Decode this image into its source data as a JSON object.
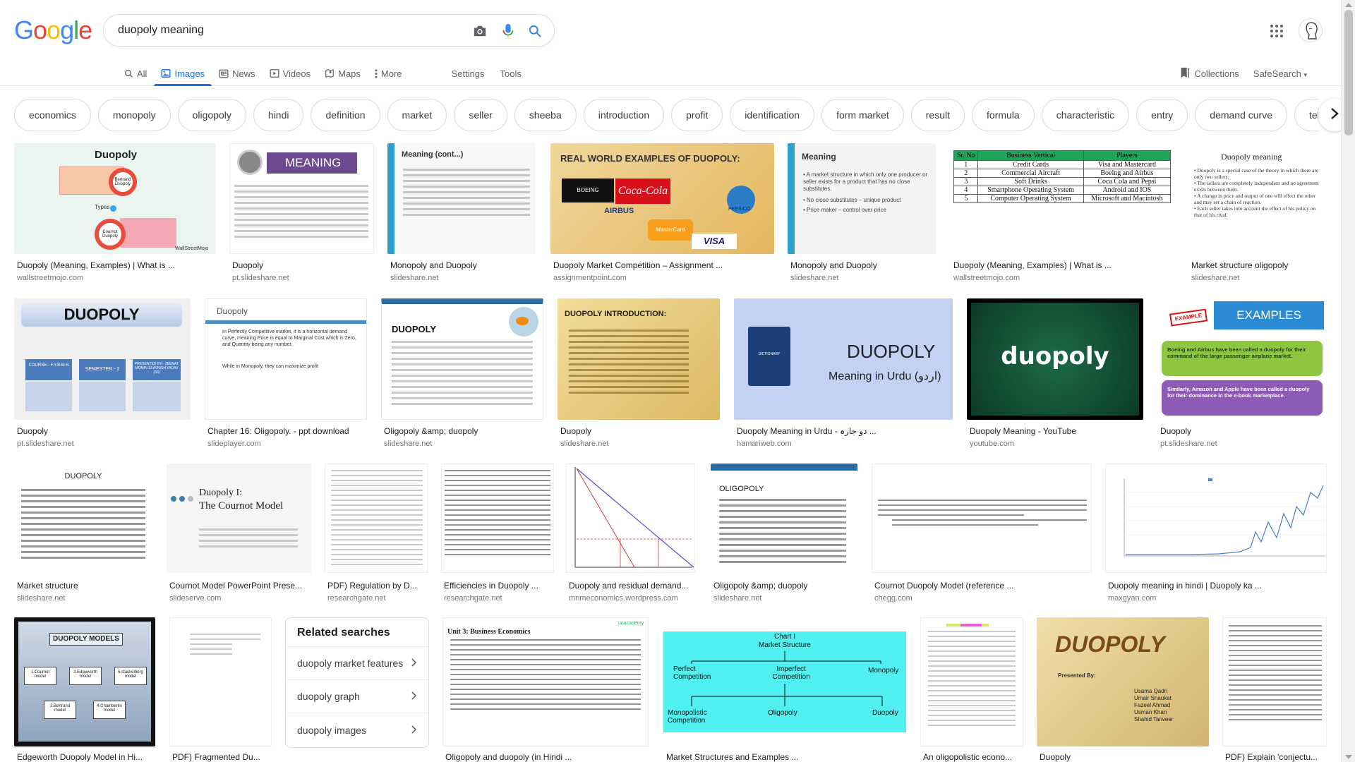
{
  "logo": [
    "G",
    "o",
    "o",
    "g",
    "l",
    "e"
  ],
  "search": {
    "query": "duopoly meaning"
  },
  "tabs": [
    {
      "label": "All"
    },
    {
      "label": "Images"
    },
    {
      "label": "News"
    },
    {
      "label": "Videos"
    },
    {
      "label": "Maps"
    },
    {
      "label": "More"
    }
  ],
  "settings_label": "Settings",
  "tools_label": "Tools",
  "collections_label": "Collections",
  "safesearch_label": "SafeSearch",
  "chips": [
    "economics",
    "monopoly",
    "oligopoly",
    "hindi",
    "definition",
    "market",
    "seller",
    "sheeba",
    "introduction",
    "profit",
    "identification",
    "form market",
    "result",
    "formula",
    "characteristic",
    "entry",
    "demand curve",
    "televisi"
  ],
  "results": [
    {
      "title": "Duopoly (Meaning, Examples) | What is ...",
      "source": "wallstreetmojo.com"
    },
    {
      "title": "Duopoly",
      "source": "pt.slideshare.net"
    },
    {
      "title": "Monopoly and Duopoly",
      "source": "slideshare.net"
    },
    {
      "title": "Duopoly Market Competition – Assignment ...",
      "source": "assignmentpoint.com"
    },
    {
      "title": "Monopoly and Duopoly",
      "source": "slideshare.net"
    },
    {
      "title": "Duopoly (Meaning, Examples) | What is ...",
      "source": "wallstreetmojo.com"
    },
    {
      "title": "Market structure oligopoly",
      "source": "slideshare.net"
    },
    {
      "title": "Duopoly",
      "source": "pt.slideshare.net"
    },
    {
      "title": "Chapter 16: Oligopoly. - ppt download",
      "source": "slideplayer.com"
    },
    {
      "title": "Oligopoly &amp; duopoly",
      "source": "slideshare.net"
    },
    {
      "title": "Duopoly",
      "source": "slideshare.net"
    },
    {
      "title": "Duopoly Meaning in Urdu - دو جارہ ...",
      "source": "hamariweb.com"
    },
    {
      "title": "Duopoly Meaning - YouTube",
      "source": "youtube.com"
    },
    {
      "title": "Duopoly",
      "source": "pt.slideshare.net"
    },
    {
      "title": "Market structure",
      "source": "slideshare.net"
    },
    {
      "title": "Cournot Model PowerPoint Prese...",
      "source": "slideserve.com"
    },
    {
      "title": "PDF) Regulation by D...",
      "source": "researchgate.net"
    },
    {
      "title": "Efficiencies in Duopoly ...",
      "source": "researchgate.net"
    },
    {
      "title": "Duopoly and residual demand...",
      "source": "mnmeconomics.wordpress.com"
    },
    {
      "title": "Oligopoly &amp; duopoly",
      "source": "slideshare.net"
    },
    {
      "title": "Cournot Duopoly Model (reference ...",
      "source": "chegg.com"
    },
    {
      "title": "Duopoly meaning in hindi | Duopoly ka ...",
      "source": "maxgyan.com"
    },
    {
      "title": "Edgeworth Duopoly Model in Hi...",
      "source": ""
    },
    {
      "title": "PDF) Fragmented Du...",
      "source": ""
    },
    {
      "title": "Oligopoly and duopoly (in Hindi ...",
      "source": ""
    },
    {
      "title": "Market Structures and Examples ...",
      "source": ""
    },
    {
      "title": "An oligopolistic econo...",
      "source": ""
    },
    {
      "title": "Duopoly",
      "source": ""
    },
    {
      "title": "PDF) Explain 'conjectu...",
      "source": ""
    }
  ],
  "thumbs": {
    "t0": {
      "title": "Duopoly",
      "item1": "Bertrand Duopoly",
      "item2": "Types",
      "item3": "Cournot Duopoly",
      "brand": "WallStreetMojo"
    },
    "t1": {
      "label": "MEANING",
      "badge": "MEANING"
    },
    "t2": {
      "title": "Meaning (cont...)"
    },
    "t3": {
      "title": "REAL WORLD EXAMPLES OF DUOPOLY:",
      "b1": "BOEING",
      "b2": "Coca-Cola",
      "b3": "AIRBUS",
      "b4": "PEPSICO",
      "b5": "MasterCard",
      "b6": "VISA"
    },
    "t4": {
      "title": "Meaning",
      "l1": "• A market structure in which only one producer or seller exists for a product that has no close substitutes.",
      "l2": "• No close substitutes – unique product",
      "l3": "• Price maker – control over price"
    },
    "t5": {
      "h1": "Sr. No",
      "h2": "Business Vertical",
      "h3": "Players",
      "rows": [
        [
          "1",
          "Credit Cards",
          "Visa and Mastercard"
        ],
        [
          "2",
          "Commercial Aircraft",
          "Boeing and Airbus"
        ],
        [
          "3",
          "Soft Drinks",
          "Coca Cola and Pepsi"
        ],
        [
          "4",
          "Smartphone Operating System",
          "Android and IOS"
        ],
        [
          "5",
          "Computer Operating System",
          "Microsoft and Macintosh"
        ]
      ]
    },
    "t6": {
      "title": "Duopoly meaning",
      "l1": "• Duopoly is a special case of the theory in which there are only two sellers.",
      "l2": "• The sellers are completely independent and no agreement exists between them.",
      "l3": "• A change in price and output of one will effect the other and may set a chain of reaction.",
      "l4": "• Each seller takes into account the effect of his policy on that of his rival."
    },
    "t7": {
      "title": "DUOPOLY",
      "b1": "COURSE:- F.Y.B.M.S",
      "b2": "SEMESTER:- 2",
      "b3": "PRESENTED BY:- ZEENAT MOMIN 13 AVNISH YADAV (63)"
    },
    "t8": {
      "title": "Duopoly",
      "l1": "In Perfectly Competitive market, it is a horizontal demand curve, meaning Price is equal to Marginal Cost which is Zero, and Quantity being any number.",
      "l2": "While in Monopoly, they can maximize profit"
    },
    "t9": {
      "title": "DUOPOLY"
    },
    "t10": {
      "title": "DUOPOLY INTRODUCTION:"
    },
    "t11": {
      "title": "DUOPOLY",
      "sub": "Meaning in Urdu (اردو)",
      "book": "DICTIONARY"
    },
    "t12": {
      "title": "duopoly"
    },
    "t13": {
      "title": "EXAMPLES",
      "tag": "EXAMPLE",
      "p1": "Boeing and Airbus have been called a duopoly for their command of the large passenger airplane market.",
      "p2": "Similarly, Amazon and Apple have been called a duopoly for their dominance in the e-book marketplace."
    },
    "t14": {
      "title": "DUOPOLY"
    },
    "t15": {
      "title": "Duopoly I:",
      "sub": "The Cournot Model"
    },
    "t19": {
      "title": "OLIGOPOLY"
    },
    "t22": {
      "title": "DUOPOLY MODELS",
      "m1": "1.Cournot model",
      "m2": "3.Edgeworth model",
      "m3": "5.stackelberg model",
      "m4": "2.Bertrand model",
      "m5": "4.Chamberlin model"
    },
    "t24": {
      "title": "Unit 3: Business Economics",
      "brand": "unacademy"
    },
    "t25": {
      "title": "Chart I",
      "sub": "Market Structure",
      "a": "Perfect Competition",
      "b": "Imperfect Competition",
      "c": "Monopoly",
      "d": "Monopolistic Competition",
      "e": "Oligopoly",
      "f": "Duopoly"
    },
    "t27": {
      "title": "DUOPOLY",
      "sub": "Presented By:",
      "n1": "Usama Qadri",
      "n2": "Umair Shaukat",
      "n3": "Fazeel Ahmad",
      "n4": "Usman Khan",
      "n5": "Shahid Tanveer"
    }
  },
  "related": {
    "heading": "Related searches",
    "items": [
      "duopoly market features",
      "duopoly graph",
      "duopoly images"
    ]
  }
}
